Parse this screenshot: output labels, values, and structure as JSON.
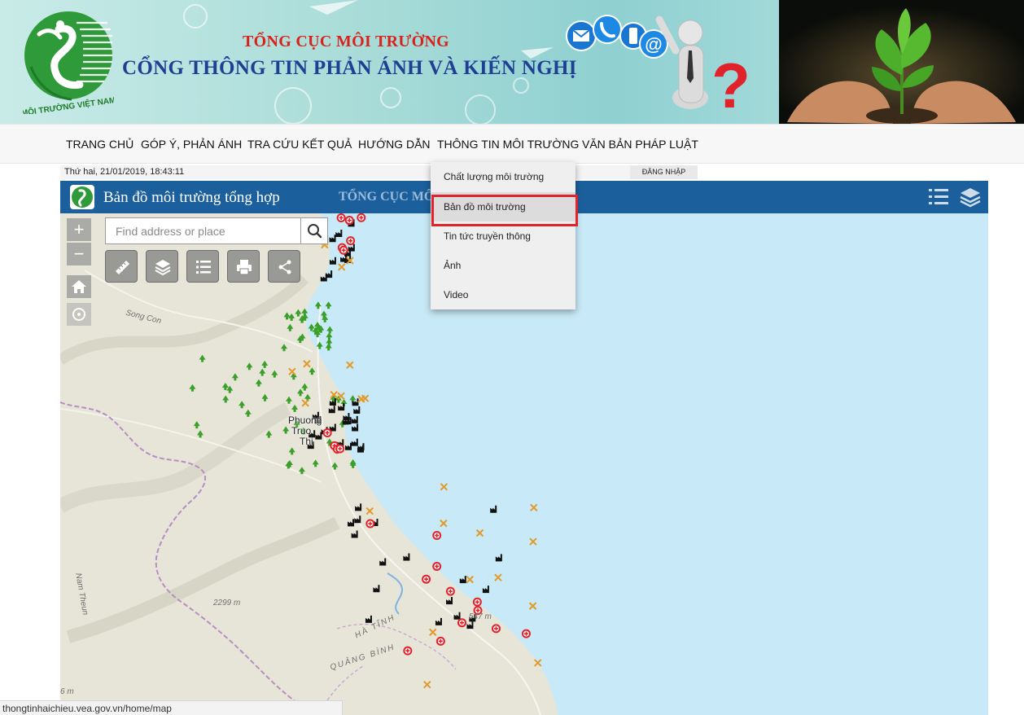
{
  "banner": {
    "org_name": "TỔNG CỤC MÔI TRƯỜNG",
    "portal_title": "CỔNG THÔNG TIN PHẢN ÁNH VÀ KIẾN NGHỊ",
    "logo_caption": "MÔI TRƯỜNG VIỆT NAM"
  },
  "nav": {
    "items": [
      {
        "label": "TRANG CHỦ"
      },
      {
        "label": "GÓP Ý, PHẢN ÁNH"
      },
      {
        "label": "TRA CỨU KẾT QUẢ"
      },
      {
        "label": "HƯỚNG DẪN"
      },
      {
        "label": "THÔNG TIN MÔI TRƯỜNG"
      },
      {
        "label": "VĂN BẢN PHÁP LUẬT"
      }
    ]
  },
  "topbar": {
    "datetime": "Thứ hai, 21/01/2019, 18:43:11",
    "login_label": "ĐĂNG NHẬP"
  },
  "dropdown": {
    "items": [
      {
        "label": "Chất lượng môi trường"
      },
      {
        "label": "Bản đồ môi trường"
      },
      {
        "label": "Tin tức truyền thông"
      },
      {
        "label": "Ảnh"
      },
      {
        "label": "Video"
      }
    ],
    "highlighted_index": 1
  },
  "map_app": {
    "title": "Bản đồ môi trường tổng hợp",
    "org": "TỔNG CỤC MÔ",
    "search_placeholder": "Find address or place",
    "zoom_in": "+",
    "zoom_out": "−"
  },
  "map": {
    "labels": {
      "song_con": "Song Con",
      "city": "Phuong Truong Thi",
      "city_l1": "Phuong",
      "city_l2": "Truo",
      "city_l3": "Thi",
      "elev_2299": "2299 m",
      "elev_547": "547 m",
      "ha_tinh": "HÀ TĨNH",
      "quang_binh": "QUẢNG BÌNH",
      "nam_theun": "Nam Theun",
      "edge_m": "6 m"
    },
    "colors": {
      "sea": "#c8e9f7",
      "land": "#e7e5d8",
      "border": "#b68ec4",
      "tree_marker": "#3aa02a",
      "factory_marker": "#111111",
      "hospital_marker": "#e0232a",
      "mining_marker": "#e29a2a"
    }
  },
  "browser_status": {
    "url": "thongtinhaichieu.vea.gov.vn/home/map"
  }
}
